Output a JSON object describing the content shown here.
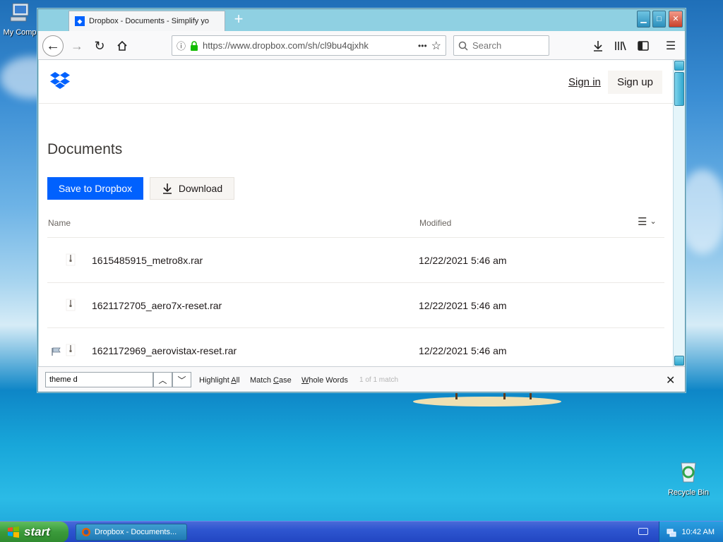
{
  "desktop": {
    "icons": [
      {
        "label": "My Comp"
      },
      {
        "label": "Recycle Bin"
      }
    ]
  },
  "browser": {
    "tab_title": "Dropbox - Documents - Simplify yo",
    "new_tab": "+",
    "url": "https://www.dropbox.com/sh/cl9bu4qjxhk",
    "search_placeholder": "Search",
    "page_actions": "•••"
  },
  "page": {
    "sign_in": "Sign in",
    "sign_up": "Sign up",
    "title": "Documents",
    "save_button": "Save to Dropbox",
    "download_button": "Download",
    "columns": {
      "name": "Name",
      "modified": "Modified"
    },
    "files": [
      {
        "name": "1615485915_metro8x.rar",
        "modified": "12/22/2021 5:46 am",
        "flagged": false
      },
      {
        "name": "1621172705_aero7x-reset.rar",
        "modified": "12/22/2021 5:46 am",
        "flagged": false
      },
      {
        "name": "1621172969_aerovistax-reset.rar",
        "modified": "12/22/2021 5:46 am",
        "flagged": true
      }
    ]
  },
  "findbar": {
    "query": "theme d",
    "highlight_all_pre": "Highlight ",
    "highlight_all_u": "A",
    "highlight_all_post": "ll",
    "match_case_pre": "Match ",
    "match_case_u": "C",
    "match_case_post": "ase",
    "whole_words_u": "W",
    "whole_words_post": "hole Words",
    "status": "1 of 1 match"
  },
  "taskbar": {
    "start": "start",
    "task_label": "Dropbox - Documents...",
    "clock": "10:42 AM"
  },
  "colors": {
    "accent": "#0061fe",
    "taskbar": "#2246c2",
    "start": "#3a9a3a"
  }
}
